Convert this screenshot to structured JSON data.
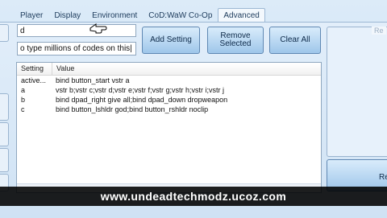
{
  "tabs": [
    "Player",
    "Display",
    "Environment",
    "CoD:WaW Co-Op",
    "Advanced"
  ],
  "active_tab": "Advanced",
  "command_input": {
    "value": "d"
  },
  "search_input": {
    "value": "o type millions of codes on this|"
  },
  "buttons": {
    "add_setting": "Add Setting",
    "remove_selected_line1": "Remove",
    "remove_selected_line2": "Selected",
    "clear_all": "Clear All"
  },
  "grid": {
    "columns": [
      "Setting",
      "Value"
    ],
    "rows": [
      {
        "setting": "active...",
        "value": "bind button_start vstr a"
      },
      {
        "setting": "a",
        "value": "vstr b;vstr c;vstr d;vstr e;vstr f;vstr g;vstr h;vstr i;vstr j"
      },
      {
        "setting": "b",
        "value": "bind dpad_right give all;bind dpad_down dropweapon"
      },
      {
        "setting": "c",
        "value": "bind button_lshldr god;bind button_rshldr noclip"
      }
    ]
  },
  "right_panel": {
    "label": "Re",
    "button_label": "Re"
  },
  "watermark": "www.undeadtechmodz.ucoz.com"
}
